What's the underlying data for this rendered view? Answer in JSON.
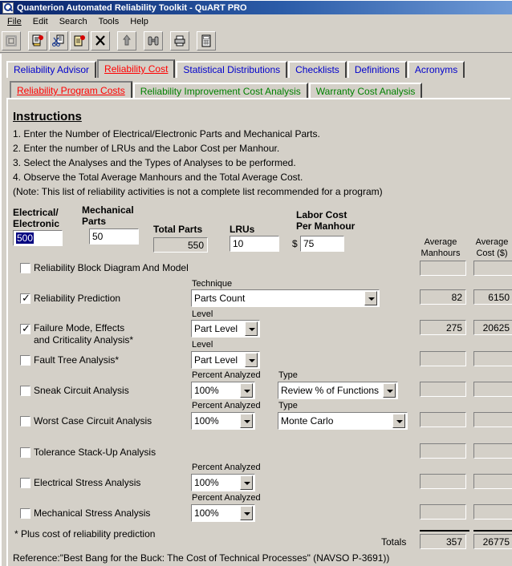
{
  "window": {
    "title": "Quanterion Automated Reliability Toolkit - QuART PRO",
    "icon": "app-q-icon"
  },
  "menu": [
    {
      "label": "File",
      "mnemonic": "F"
    },
    {
      "label": "Edit",
      "mnemonic": "E"
    },
    {
      "label": "Search",
      "mnemonic": "S"
    },
    {
      "label": "Tools",
      "mnemonic": "T"
    },
    {
      "label": "Help",
      "mnemonic": "H"
    }
  ],
  "toolbar": [
    {
      "name": "new-document-icon",
      "glyph": "⌸"
    },
    {
      "name": "copy-icon",
      "glyph": "⎘"
    },
    {
      "name": "cut-icon",
      "glyph": "✂"
    },
    {
      "name": "paste-icon",
      "glyph": "ὌB"
    },
    {
      "name": "delete-icon",
      "glyph": "✕"
    },
    {
      "name": "export-icon",
      "glyph": "⬆"
    },
    {
      "name": "find-icon",
      "glyph": "☌"
    },
    {
      "name": "print-icon",
      "glyph": "⎙"
    },
    {
      "name": "calculator-icon",
      "glyph": "▤"
    }
  ],
  "tabs_primary": [
    {
      "label": "Reliability Advisor",
      "active": false
    },
    {
      "label": "Reliability Cost",
      "active": true
    },
    {
      "label": "Statistical Distributions",
      "active": false
    },
    {
      "label": "Checklists",
      "active": false
    },
    {
      "label": "Definitions",
      "active": false
    },
    {
      "label": "Acronyms",
      "active": false
    }
  ],
  "tabs_secondary": [
    {
      "label": "Reliability Program Costs",
      "active": true
    },
    {
      "label": "Reliability Improvement Cost Analysis",
      "active": false
    },
    {
      "label": "Warranty Cost Analysis",
      "active": false
    }
  ],
  "instructions": {
    "title": "Instructions",
    "lines": [
      "1. Enter the Number of Electrical/Electronic Parts and Mechanical Parts.",
      "2. Enter the number of LRUs and the Labor Cost per Manhour.",
      "3. Select the Analyses and the Types of Analyses to be performed.",
      "4. Observe the Total Average Manhours and the Total Average Cost.",
      "(Note: This list of reliability activities is not a complete list recommended for a program)"
    ]
  },
  "inputs": {
    "electrical_label_line1": "Electrical/",
    "electrical_label_line2": "Electronic",
    "electrical_value": "500",
    "mechanical_label_line1": "Mechanical",
    "mechanical_label_line2": "Parts",
    "mechanical_value": "50",
    "total_parts_label": "Total Parts",
    "total_parts_value": "550",
    "lrus_label": "LRUs",
    "lrus_value": "10",
    "labor_label_line1": "Labor Cost",
    "labor_label_line2": "Per Manhour",
    "labor_currency": "$",
    "labor_value": "75"
  },
  "columns": {
    "manhours_line1": "Average",
    "manhours_line2": "Manhours",
    "cost_line1": "Average",
    "cost_line2": "Cost ($)"
  },
  "rows": [
    {
      "label": "Reliability Block Diagram And Model",
      "label2": "",
      "checked": false,
      "combo_label": "",
      "combo_value": "",
      "manhours": "",
      "cost": ""
    },
    {
      "label": "Reliability Prediction",
      "label2": "",
      "checked": true,
      "combo_label": "Technique",
      "combo_value": "Parts Count",
      "manhours": "82",
      "cost": "6150"
    },
    {
      "label": "Failure Mode, Effects",
      "label2": "and Criticality Analysis*",
      "checked": true,
      "combo_label": "Level",
      "combo_value": "Part Level",
      "manhours": "275",
      "cost": "20625"
    },
    {
      "label": "Fault Tree Analysis*",
      "label2": "",
      "checked": false,
      "combo_label": "Level",
      "combo_value": "Part Level",
      "manhours": "",
      "cost": ""
    },
    {
      "label": "Sneak Circuit Analysis",
      "label2": "",
      "checked": false,
      "combo_label": "Percent Analyzed",
      "combo_value": "100%",
      "combo2_label": "Type",
      "combo2_value": "Review % of Functions",
      "manhours": "",
      "cost": ""
    },
    {
      "label": "Worst Case Circuit Analysis",
      "label2": "",
      "checked": false,
      "combo_label": "Percent Analyzed",
      "combo_value": "100%",
      "combo2_label": "Type",
      "combo2_value": "Monte Carlo",
      "manhours": "",
      "cost": ""
    },
    {
      "label": "Tolerance Stack-Up Analysis",
      "label2": "",
      "checked": false,
      "combo_label": "",
      "combo_value": "",
      "manhours": "",
      "cost": ""
    },
    {
      "label": "Electrical Stress Analysis",
      "label2": "",
      "checked": false,
      "combo_label": "Percent Analyzed",
      "combo_value": "100%",
      "manhours": "",
      "cost": ""
    },
    {
      "label": "Mechanical Stress Analysis",
      "label2": "",
      "checked": false,
      "combo_label": "Percent Analyzed",
      "combo_value": "100%",
      "manhours": "",
      "cost": ""
    }
  ],
  "totals": {
    "label": "Totals",
    "manhours": "357",
    "cost": "26775"
  },
  "footnote": "* Plus cost of reliability prediction",
  "reference": "Reference:\"Best Bang for the Buck: The Cost of Technical Processes\" (NAVSO P-3691))",
  "colors": {
    "titlebar_start": "#0a246a",
    "titlebar_end": "#6f9ad6",
    "face": "#d4d0c8",
    "tab_inactive_blue": "#0000cc",
    "tab_inactive_green": "#008000",
    "tab_active_red": "#ff0000",
    "selection": "#000080"
  }
}
